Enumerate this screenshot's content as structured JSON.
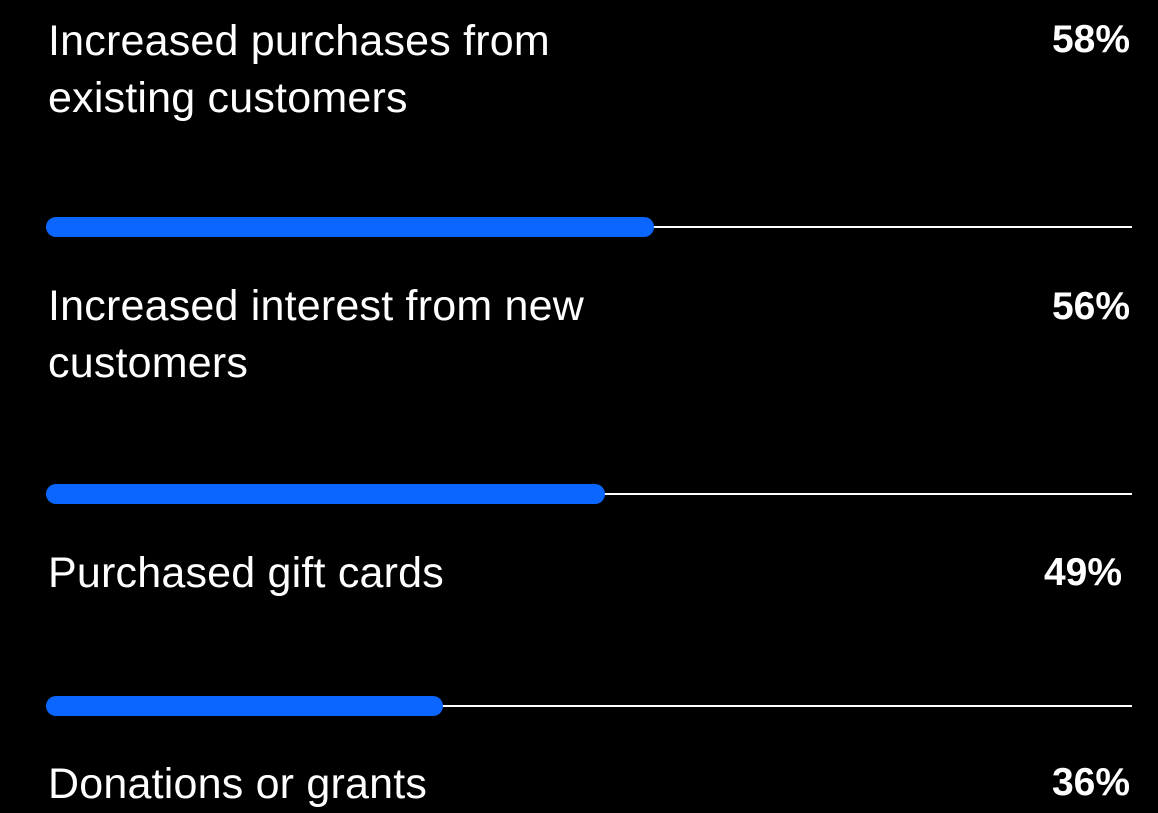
{
  "accent_color": "#0a66ff",
  "background_color": "#000000",
  "chart_data": {
    "type": "bar",
    "orientation": "horizontal",
    "categories": [
      "Increased purchases from existing customers",
      "Increased interest from new customers",
      "Purchased gift cards",
      "Donations or grants"
    ],
    "values": [
      58,
      56,
      49,
      36
    ],
    "value_labels": [
      "58%",
      "56%",
      "49%",
      "36%"
    ],
    "xlim": [
      0,
      100
    ],
    "unit": "%",
    "grid": false,
    "legend": "none",
    "title": "",
    "xlabel": "",
    "ylabel": ""
  }
}
